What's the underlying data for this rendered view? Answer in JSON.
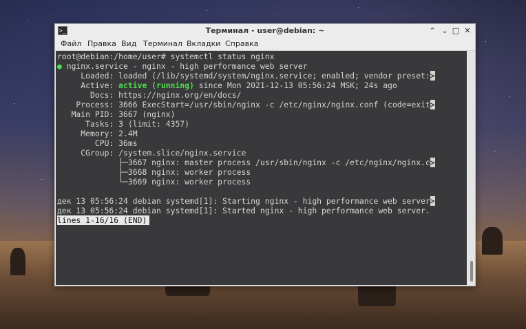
{
  "window": {
    "title": "Терминал - user@debian: ~",
    "app_icon": "terminal-icon",
    "controls": {
      "minimize": "⌃",
      "maximize": "⌄",
      "restore": "□",
      "close": "✕"
    }
  },
  "menu": {
    "items": [
      "Файл",
      "Правка",
      "Вид",
      "Терминал",
      "Вкладки",
      "Справка"
    ]
  },
  "terminal": {
    "prompt_line": "root@debian:/home/user# systemctl status nginx",
    "bullet": "●",
    "unit_line": " nginx.service - nginx - high performance web server",
    "loaded": "     Loaded: loaded (/lib/systemd/system/nginx.service; enabled; vendor preset:",
    "active_label": "     Active: ",
    "active_status": "active (running)",
    "active_rest": " since Mon 2021-12-13 05:56:24 MSK; 24s ago",
    "docs": "       Docs: https://nginx.org/en/docs/",
    "process": "    Process: 3666 ExecStart=/usr/sbin/nginx -c /etc/nginx/nginx.conf (code=exit",
    "main_pid": "   Main PID: 3667 (nginx)",
    "tasks": "      Tasks: 3 (limit: 4357)",
    "memory": "     Memory: 2.4M",
    "cpu": "        CPU: 36ms",
    "cgroup": "     CGroup: /system.slice/nginx.service",
    "cgroup_1": "             ├─3667 nginx: master process /usr/sbin/nginx -c /etc/nginx/nginx.c",
    "cgroup_2": "             ├─3668 nginx: worker process",
    "cgroup_3": "             └─3669 nginx: worker process",
    "log_1": "дек 13 05:56:24 debian systemd[1]: Starting nginx - high performance web server",
    "log_2": "дек 13 05:56:24 debian systemd[1]: Started nginx - high performance web server.",
    "truncation_marker": ">",
    "pager_status": "lines 1-16/16 (END)"
  },
  "colors": {
    "terminal_bg": "#08080c",
    "terminal_fg": "#d3d7cf",
    "active_green": "#4ce04c"
  }
}
